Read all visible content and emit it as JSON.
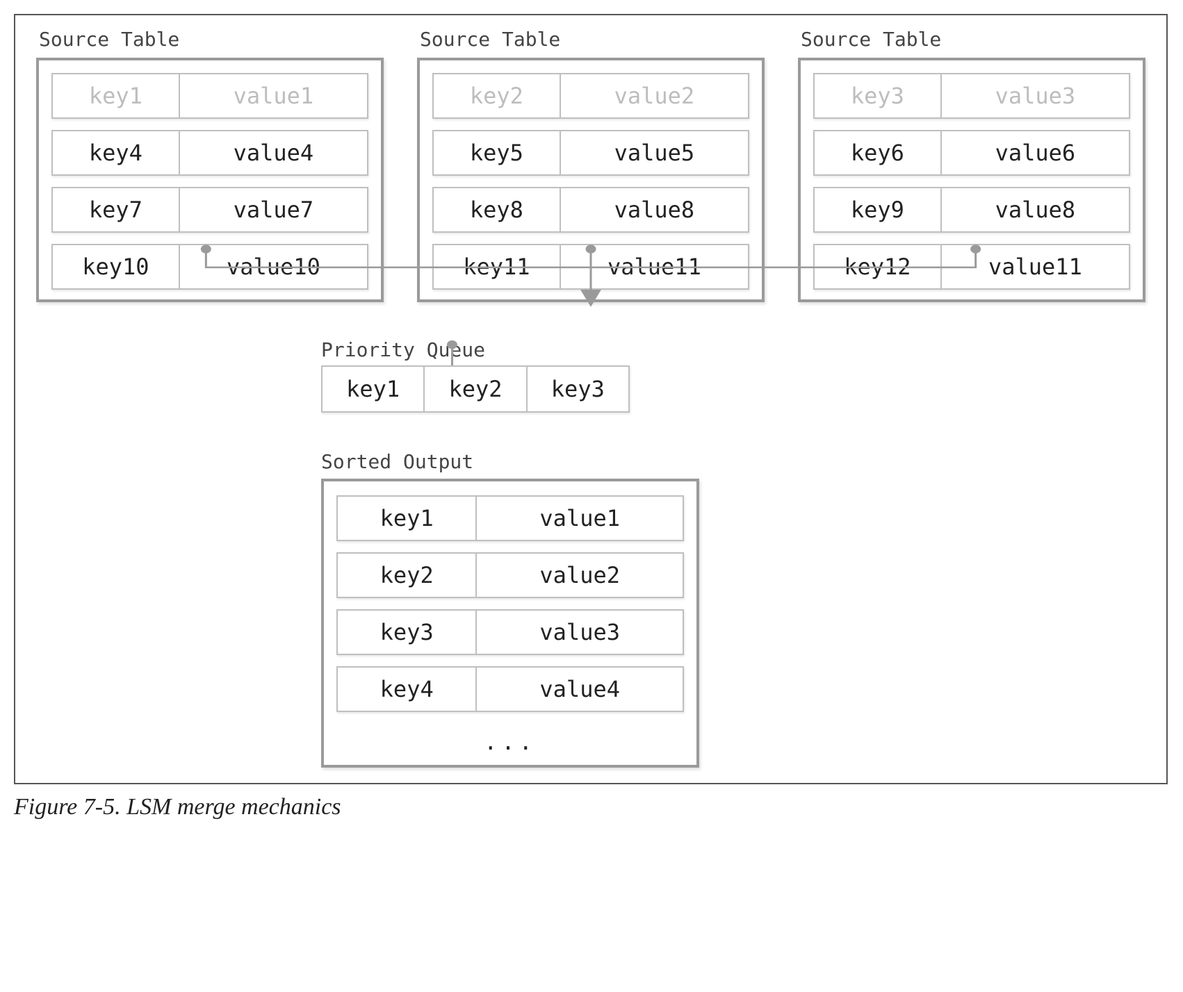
{
  "caption": "Figure 7-5. LSM merge mechanics",
  "titles": {
    "source": "Source Table",
    "pq": "Priority Queue",
    "out": "Sorted Output"
  },
  "source_tables": [
    [
      {
        "key": "key1",
        "value": "value1",
        "faded": true
      },
      {
        "key": "key4",
        "value": "value4",
        "faded": false
      },
      {
        "key": "key7",
        "value": "value7",
        "faded": false
      },
      {
        "key": "key10",
        "value": "value10",
        "faded": false
      }
    ],
    [
      {
        "key": "key2",
        "value": "value2",
        "faded": true
      },
      {
        "key": "key5",
        "value": "value5",
        "faded": false
      },
      {
        "key": "key8",
        "value": "value8",
        "faded": false
      },
      {
        "key": "key11",
        "value": "value11",
        "faded": false
      }
    ],
    [
      {
        "key": "key3",
        "value": "value3",
        "faded": true
      },
      {
        "key": "key6",
        "value": "value6",
        "faded": false
      },
      {
        "key": "key9",
        "value": "value8",
        "faded": false
      },
      {
        "key": "key12",
        "value": "value11",
        "faded": false
      }
    ]
  ],
  "priority_queue": [
    "key1",
    "key2",
    "key3"
  ],
  "sorted_output": [
    {
      "key": "key1",
      "value": "value1"
    },
    {
      "key": "key2",
      "value": "value2"
    },
    {
      "key": "key3",
      "value": "value3"
    },
    {
      "key": "key4",
      "value": "value4"
    }
  ],
  "ellipsis": "..."
}
